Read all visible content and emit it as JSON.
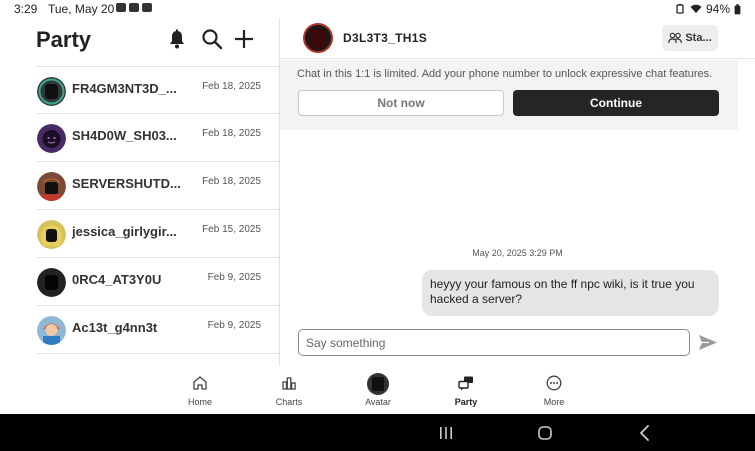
{
  "status_bar": {
    "time": "3:29",
    "date": "Tue, May 20",
    "battery": "94%"
  },
  "left_panel": {
    "title": "Party",
    "conversations": [
      {
        "name": "FR4GM3NT3D_...",
        "date": "Feb 18, 2025"
      },
      {
        "name": "SH4D0W_SH03...",
        "date": "Feb 18, 2025"
      },
      {
        "name": "SERVERSHUTD...",
        "date": "Feb 18, 2025"
      },
      {
        "name": "jessica_girlygir...",
        "date": "Feb 15, 2025"
      },
      {
        "name": "0RC4_AT3Y0U",
        "date": "Feb 9, 2025"
      },
      {
        "name": "Ac13t_g4nn3t",
        "date": "Feb 9, 2025"
      }
    ]
  },
  "chat": {
    "title": "D3L3T3_TH1S",
    "status_button": "Sta...",
    "notice": "Chat in this 1:1 is limited. Add your phone number to unlock expressive chat features.",
    "not_now_label": "Not now",
    "continue_label": "Continue",
    "timestamp": "May 20, 2025 3:29 PM",
    "message": "heyyy your famous on the ff npc wiki, is it true you hacked a server?",
    "input_placeholder": "Say something"
  },
  "bottom_nav": [
    {
      "label": "Home",
      "icon": "home-icon"
    },
    {
      "label": "Charts",
      "icon": "charts-icon"
    },
    {
      "label": "Avatar",
      "icon": "avatar-icon"
    },
    {
      "label": "Party",
      "icon": "party-icon",
      "active": true
    },
    {
      "label": "More",
      "icon": "more-icon"
    }
  ],
  "colors": {
    "accent_dark": "#232527",
    "bubble": "#e5e5e6",
    "notice_bg": "#f3f3f3"
  }
}
